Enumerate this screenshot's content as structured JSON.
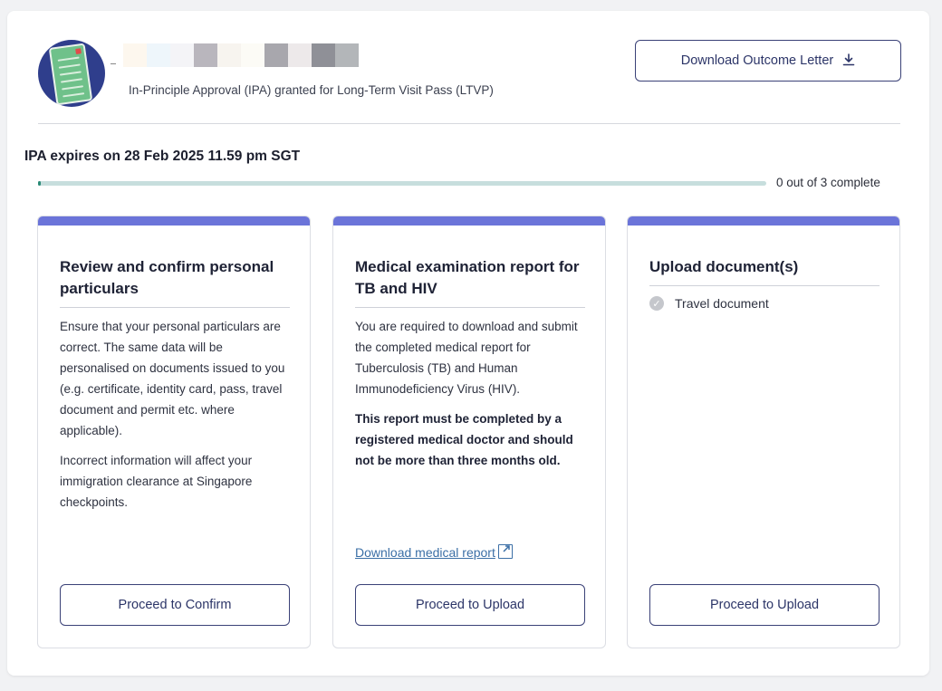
{
  "header": {
    "subtitle": "In-Principle Approval (IPA) granted for Long-Term Visit Pass (LTVP)",
    "download_letter_label": "Download Outcome Letter",
    "download_icon": "download-icon"
  },
  "status": {
    "expiry_text": "IPA expires on 28 Feb 2025 11.59 pm SGT",
    "progress_completed": 0,
    "progress_total": 3,
    "progress_text": "0 out of 3 complete"
  },
  "colors": {
    "accent_bar": "#6b74d9",
    "button_border": "#3a4177",
    "progress_track": "#c7dedd",
    "progress_fill": "#2a8a76",
    "link": "#3b6fa6",
    "avatar_bg": "#2f3e8c"
  },
  "cards": [
    {
      "title": "Review and confirm personal particulars",
      "paragraphs": [
        "Ensure that your personal particulars are correct. The same data will be personalised on documents issued to you (e.g. certificate, identity card, pass, travel document and permit etc. where applicable).",
        "Incorrect information will affect your immigration clearance at Singapore checkpoints."
      ],
      "button_label": "Proceed to Confirm"
    },
    {
      "title": "Medical examination report for TB and HIV",
      "paragraphs": [
        "You are required to download and submit the completed medical report for Tuberculosis (TB) and Human Immunodeficiency Virus (HIV).",
        "This report must be completed by a registered medical doctor and should not be more than three months old."
      ],
      "link_label": "Download medical report",
      "button_label": "Proceed to Upload"
    },
    {
      "title": "Upload document(s)",
      "items": [
        "Travel document"
      ],
      "button_label": "Proceed to Upload"
    }
  ]
}
